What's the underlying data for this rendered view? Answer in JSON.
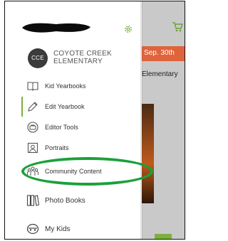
{
  "school": {
    "logo_text": "CCE",
    "name_line1": "COYOTE CREEK",
    "name_line2": "ELEMENTARY"
  },
  "menu": {
    "sub_items": [
      {
        "label": "Kid Yearbooks",
        "icon": "book-open-icon"
      },
      {
        "label": "Edit Yearbook",
        "icon": "pencil-edit-icon"
      },
      {
        "label": "Editor Tools",
        "icon": "toolbox-icon"
      },
      {
        "label": "Portraits",
        "icon": "portrait-icon"
      },
      {
        "label": "Community Content",
        "icon": "people-icon"
      }
    ],
    "top_items": [
      {
        "label": "Photo Books",
        "icon": "photo-books-icon"
      },
      {
        "label": "My Kids",
        "icon": "kids-icon"
      }
    ],
    "active_item": "Edit Yearbook",
    "highlighted_item": "Community Content"
  },
  "background_app": {
    "banner_date": "Sep. 30th",
    "subtitle": "Elementary"
  },
  "colors": {
    "accent_green": "#7bb03a",
    "banner_orange": "#e0633b",
    "highlight_ring": "#1aa13b"
  }
}
